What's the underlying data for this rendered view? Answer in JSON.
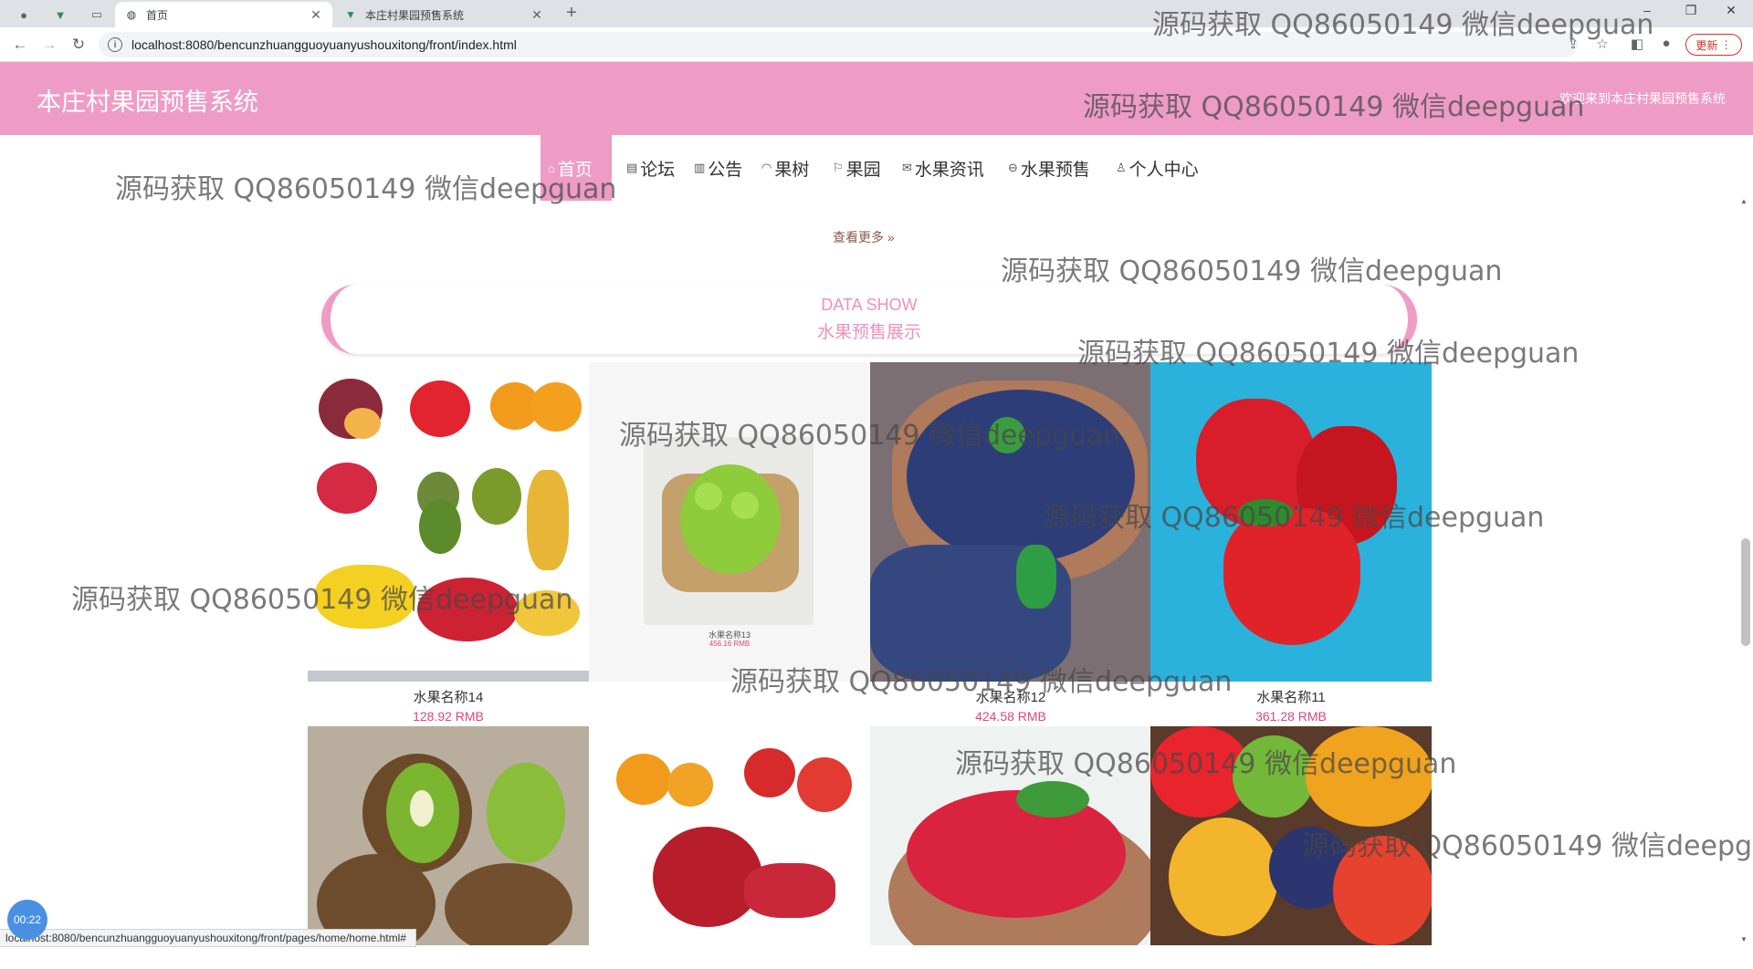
{
  "browser": {
    "tabs": [
      {
        "title": "首页",
        "active": true
      },
      {
        "title": "本庄村果园预售系统",
        "active": false
      }
    ],
    "url": "localhost:8080/bencunzhuangguoyuanyushouxitong/front/index.html",
    "update_label": "更新",
    "status_url": "localhost:8080/bencunzhuangguoyuanyushouxitong/front/pages/home/home.html#",
    "timer": "00:22"
  },
  "header": {
    "site_title": "本庄村果园预售系统",
    "welcome": "欢迎来到本庄村果园预售系统"
  },
  "menu": [
    {
      "label": "首页",
      "icon": "home-icon",
      "active": true
    },
    {
      "label": "论坛",
      "icon": "forum-icon",
      "active": false
    },
    {
      "label": "公告",
      "icon": "notice-icon",
      "active": false
    },
    {
      "label": "果树",
      "icon": "tree-icon",
      "active": false
    },
    {
      "label": "果园",
      "icon": "flag-icon",
      "active": false
    },
    {
      "label": "水果资讯",
      "icon": "mail-icon",
      "active": false
    },
    {
      "label": "水果预售",
      "icon": "cart-icon",
      "active": false
    },
    {
      "label": "个人中心",
      "icon": "user-icon",
      "active": false
    }
  ],
  "content": {
    "more_link": "查看更多",
    "banner_en": "DATA SHOW",
    "banner_cn": "水果预售展示",
    "products": [
      {
        "name": "水果名称14",
        "price": "128.92 RMB"
      },
      {
        "name": "水果名称13",
        "price": "456.16 RMB"
      },
      {
        "name": "水果名称12",
        "price": "424.58 RMB"
      },
      {
        "name": "水果名称11",
        "price": "361.28 RMB"
      },
      {
        "name": "",
        "price": ""
      },
      {
        "name": "",
        "price": ""
      },
      {
        "name": "",
        "price": ""
      },
      {
        "name": "",
        "price": ""
      }
    ]
  },
  "watermark_text": "源码获取 QQ86050149 微信deepguan",
  "colors": {
    "primary_pink": "#ee9cc6",
    "price_red": "#e0457b"
  }
}
